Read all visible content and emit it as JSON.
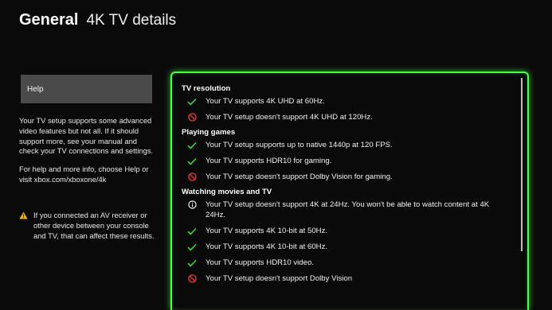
{
  "header": {
    "section": "General",
    "page": "4K TV details"
  },
  "help_button": {
    "label": "Help"
  },
  "left_text": {
    "para1": "Your TV setup supports some advanced video features but not all. If it should support more, see your manual and check your TV connections and settings.",
    "para2": "For help and more info, choose Help or visit xbox.com/xboxone/4k"
  },
  "warning": {
    "text": "If you connected an AV receiver or other device between your console and TV, that can affect these results."
  },
  "groups": [
    {
      "title": "TV resolution",
      "items": [
        {
          "status": "check",
          "text": "Your TV supports 4K UHD at 60Hz."
        },
        {
          "status": "block",
          "text": "Your TV setup doesn't support 4K UHD at 120Hz."
        }
      ]
    },
    {
      "title": "Playing games",
      "items": [
        {
          "status": "check",
          "text": "Your TV setup supports up to native 1440p at 120 FPS."
        },
        {
          "status": "check",
          "text": "Your TV supports HDR10 for gaming."
        },
        {
          "status": "block",
          "text": "Your TV setup doesn't support Dolby Vision for gaming."
        }
      ]
    },
    {
      "title": "Watching movies and TV",
      "items": [
        {
          "status": "info",
          "text": "Your TV setup doesn't support 4K at 24Hz. You won't be able to watch content at 4K 24Hz."
        },
        {
          "status": "check",
          "text": "Your TV supports 4K 10-bit at 50Hz."
        },
        {
          "status": "check",
          "text": "Your TV supports 4K 10-bit at 60Hz."
        },
        {
          "status": "check",
          "text": "Your TV supports HDR10 video."
        },
        {
          "status": "block",
          "text": "Your TV setup doesn't support Dolby Vision"
        }
      ]
    }
  ],
  "colors": {
    "accent": "#4cff48",
    "check": "#3fd43a",
    "block": "#e5312b",
    "info": "#ffffff",
    "warning": "#f0b400"
  }
}
